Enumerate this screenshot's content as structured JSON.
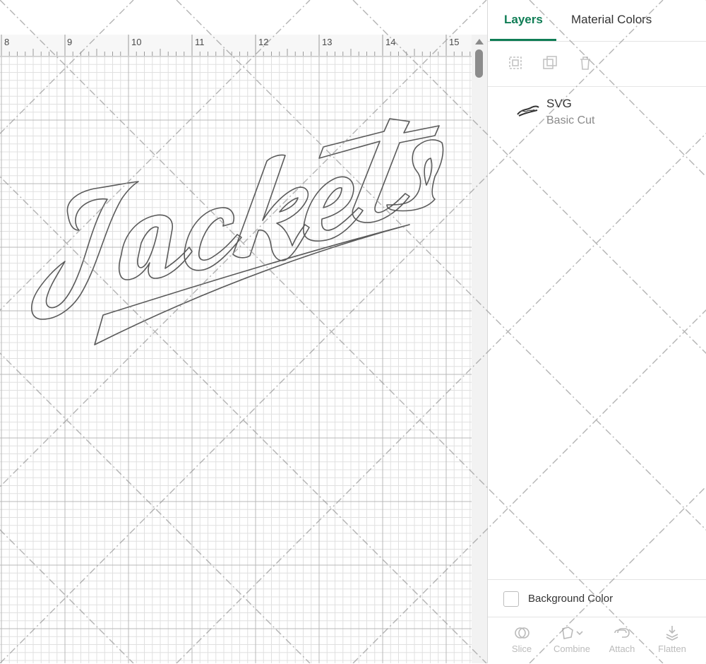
{
  "ruler": {
    "labels": [
      "8",
      "9",
      "10",
      "11",
      "12",
      "13",
      "14",
      "15"
    ]
  },
  "canvas": {
    "design_text": "Jackets"
  },
  "panel": {
    "tabs": [
      {
        "label": "Layers",
        "active": true
      },
      {
        "label": "Material Colors",
        "active": false
      }
    ],
    "toolbar_icons": [
      "group-icon",
      "duplicate-icon",
      "delete-icon"
    ],
    "layer": {
      "name": "SVG",
      "operation": "Basic Cut"
    },
    "background_color": {
      "label": "Background Color",
      "checked": false
    },
    "bottom_tools": [
      {
        "label": "Slice",
        "icon": "slice-icon"
      },
      {
        "label": "Combine",
        "icon": "combine-icon"
      },
      {
        "label": "Attach",
        "icon": "attach-icon"
      },
      {
        "label": "Flatten",
        "icon": "flatten-icon"
      }
    ]
  },
  "colors": {
    "accent": "#0f7d55",
    "grid_major": "#b5b5b5",
    "grid_minor": "#dcdcdc",
    "design_stroke": "#555555"
  }
}
